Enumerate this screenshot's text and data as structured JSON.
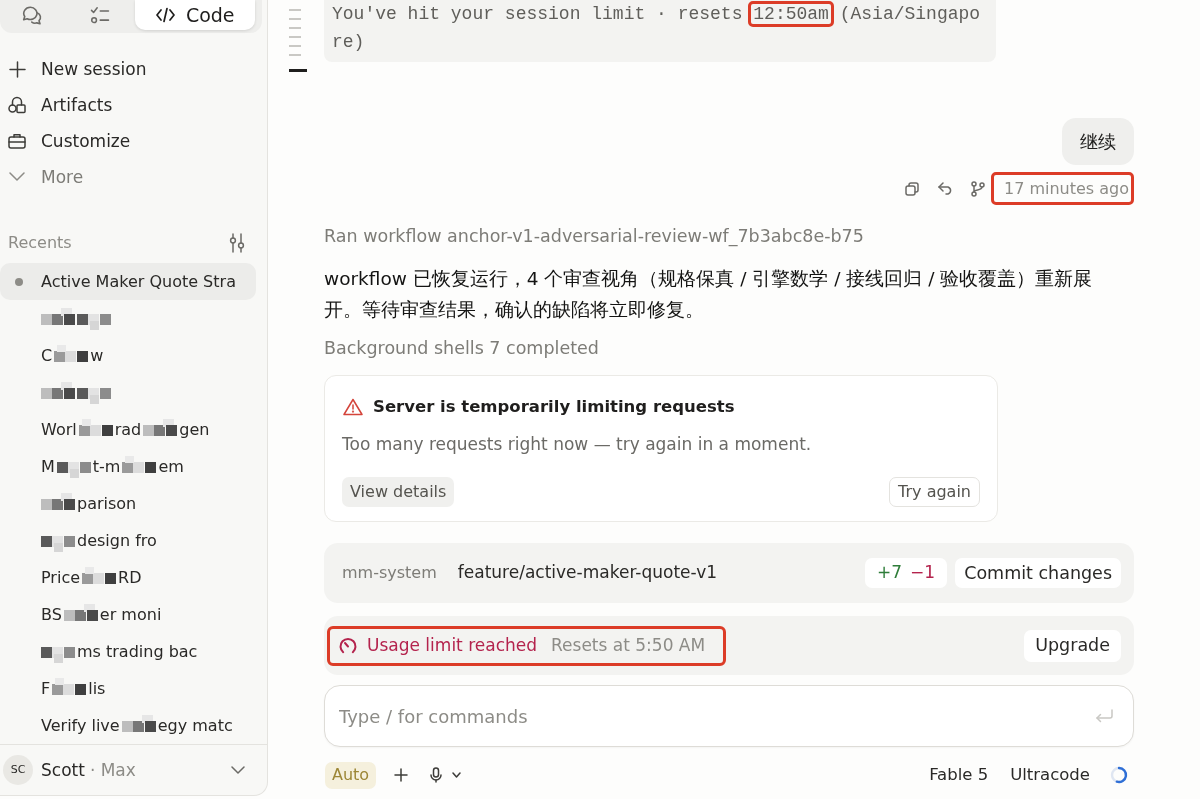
{
  "sidebar": {
    "mode_tabs": [
      {
        "kind": "chat",
        "selected": false
      },
      {
        "kind": "tasks",
        "selected": false
      },
      {
        "kind": "code",
        "label": "Code",
        "selected": true
      }
    ],
    "nav": [
      {
        "kind": "new",
        "label": "New session"
      },
      {
        "kind": "artifacts",
        "label": "Artifacts"
      },
      {
        "kind": "customize",
        "label": "Customize"
      },
      {
        "kind": "more",
        "label": "More",
        "expanded": false
      }
    ],
    "recents": {
      "title": "Recents",
      "items": [
        {
          "segments": [
            {
              "kind": "text",
              "text": "Active Maker Quote Stra"
            }
          ],
          "selected": true,
          "active": true
        },
        {
          "segments": [
            {
              "kind": "redacted"
            },
            {
              "kind": "redacted"
            }
          ],
          "selected": false,
          "active": false
        },
        {
          "segments": [
            {
              "kind": "text",
              "text": "C"
            },
            {
              "kind": "redacted"
            },
            {
              "kind": "text",
              "text": "w"
            }
          ],
          "selected": false,
          "active": false
        },
        {
          "segments": [
            {
              "kind": "redacted"
            },
            {
              "kind": "redacted"
            }
          ],
          "selected": false,
          "active": false
        },
        {
          "segments": [
            {
              "kind": "text",
              "text": "Worl"
            },
            {
              "kind": "redacted"
            },
            {
              "kind": "text",
              "text": "rad"
            },
            {
              "kind": "redacted"
            },
            {
              "kind": "text",
              "text": "gen"
            }
          ],
          "selected": false,
          "active": false
        },
        {
          "segments": [
            {
              "kind": "text",
              "text": "M"
            },
            {
              "kind": "redacted"
            },
            {
              "kind": "text",
              "text": "t-m"
            },
            {
              "kind": "redacted"
            },
            {
              "kind": "text",
              "text": "em"
            }
          ],
          "selected": false,
          "active": false
        },
        {
          "segments": [
            {
              "kind": "redacted"
            },
            {
              "kind": "text",
              "text": "parison"
            }
          ],
          "selected": false,
          "active": false
        },
        {
          "segments": [
            {
              "kind": "redacted"
            },
            {
              "kind": "text",
              "text": "design fro"
            }
          ],
          "selected": false,
          "active": false
        },
        {
          "segments": [
            {
              "kind": "text",
              "text": "Price"
            },
            {
              "kind": "redacted"
            },
            {
              "kind": "text",
              "text": "RD"
            }
          ],
          "selected": false,
          "active": false
        },
        {
          "segments": [
            {
              "kind": "text",
              "text": "BS"
            },
            {
              "kind": "redacted"
            },
            {
              "kind": "text",
              "text": "er moni"
            }
          ],
          "selected": false,
          "active": false
        },
        {
          "segments": [
            {
              "kind": "redacted"
            },
            {
              "kind": "text",
              "text": "ms trading bac"
            }
          ],
          "selected": false,
          "active": false
        },
        {
          "segments": [
            {
              "kind": "text",
              "text": "F"
            },
            {
              "kind": "redacted"
            },
            {
              "kind": "text",
              "text": "lis"
            }
          ],
          "selected": false,
          "active": false
        },
        {
          "segments": [
            {
              "kind": "text",
              "text": "Verify live"
            },
            {
              "kind": "redacted"
            },
            {
              "kind": "text",
              "text": "egy matc"
            }
          ],
          "selected": false,
          "active": false
        }
      ]
    },
    "user": {
      "initials": "SC",
      "name": "Scott",
      "plan": "· Max"
    }
  },
  "conversation": {
    "notice": {
      "text": "You've hit your session limit · resets ",
      "reset_time": "12:50am",
      "timezone": " (Asia/Singapore)",
      "reset_time_highlighted": true
    },
    "user_message": {
      "text": "继续",
      "time": "17 minutes ago",
      "time_highlighted": true
    },
    "tool_run": "Ran workflow anchor-v1-adversarial-review-wf_7b3abc8e-b75",
    "reply": "workflow 已恢复运行，4 个审查视角（规格保真 / 引擎数学 / 接线回归 / 验收覆盖）重新展开。等待审查结果，确认的缺陷将立即修复。",
    "background": "Background shells 7 completed",
    "alert": {
      "title": "Server is temporarily limiting requests",
      "message": "Too many requests right now — try again in a moment.",
      "buttons": [
        {
          "kind": "filled",
          "label": "View details"
        },
        {
          "kind": "outlined",
          "label": "Try again"
        }
      ]
    }
  },
  "git_bar": {
    "repo": "mm-system",
    "branch": "feature/active-maker-quote-v1",
    "additions": "+7",
    "deletions": "−1",
    "button": "Commit changes"
  },
  "usage_banner": {
    "status": "Usage limit reached",
    "reset": "Resets at 5:50 AM",
    "highlighted": true,
    "button": "Upgrade"
  },
  "composer": {
    "placeholder": "Type / for commands"
  },
  "toolbar": {
    "mode": "Auto",
    "model": "Fable 5",
    "effort": "Ultracode",
    "context": {
      "level": 0.55
    }
  }
}
